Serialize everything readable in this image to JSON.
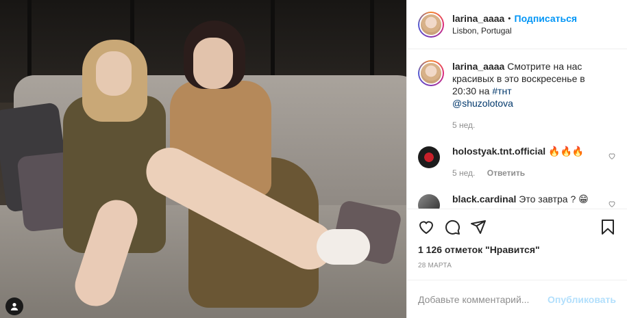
{
  "post": {
    "username": "larina_aaaa",
    "separator": "•",
    "follow_label": "Подписаться",
    "location": "Lisbon, Portugal"
  },
  "caption": {
    "username": "larina_aaaa",
    "text": "Смотрите на нас красивых в это воскресенье в 20:30 на ",
    "hashtag": "#тнт",
    "mention": "@shuzolotova",
    "age": "5 нед."
  },
  "comments": [
    {
      "username": "holostyak.tnt.official",
      "text": "🔥🔥🔥",
      "age": "5 нед.",
      "reply_label": "Ответить"
    },
    {
      "username": "black.cardinal",
      "text": "Это завтра ? 😁"
    }
  ],
  "likes_text": "1 126 отметок \"Нравится\"",
  "date_text": "28 МАРТА",
  "add_comment": {
    "placeholder": "Добавьте комментарий...",
    "post_label": "Опубликовать"
  },
  "icons": {
    "like": "heart-icon",
    "comment": "comment-icon",
    "share": "share-icon",
    "save": "bookmark-icon",
    "user_tag": "user-tag-icon"
  },
  "colors": {
    "accent": "#0095f6",
    "muted": "#8e8e8e",
    "text": "#262626",
    "post_disabled": "#b2dffc"
  }
}
